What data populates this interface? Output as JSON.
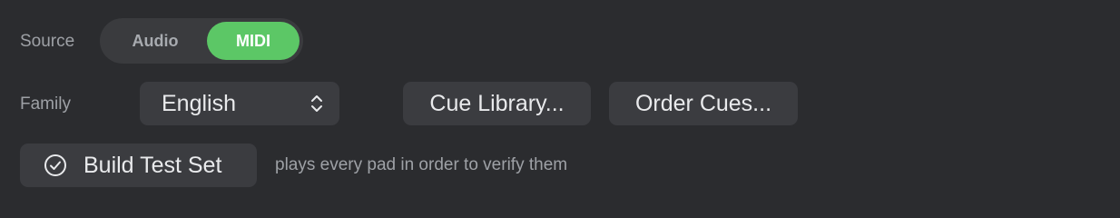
{
  "source": {
    "label": "Source",
    "options": [
      "Audio",
      "MIDI"
    ],
    "selected": "MIDI",
    "accent_color": "#5cc766"
  },
  "family": {
    "label": "Family",
    "value": "English",
    "icon": "chevron-up-down-icon"
  },
  "buttons": {
    "cue_library": "Cue Library...",
    "order_cues": "Order Cues..."
  },
  "build": {
    "label": "Build Test Set",
    "icon": "checkmark-circle-icon",
    "hint": "plays every pad in order to verify them"
  }
}
